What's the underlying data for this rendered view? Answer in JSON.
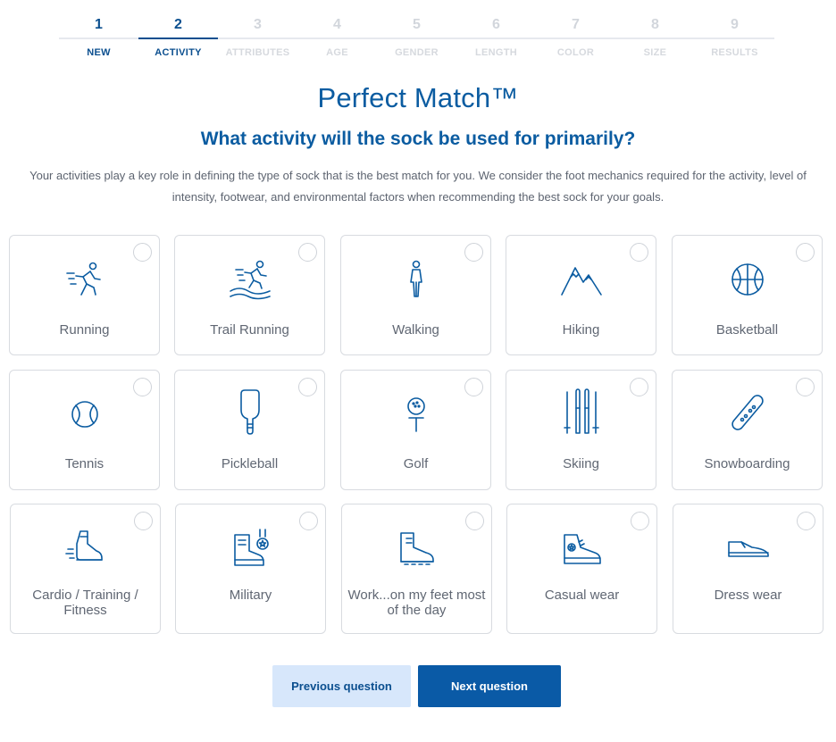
{
  "steps": [
    {
      "num": "1",
      "label": "NEW"
    },
    {
      "num": "2",
      "label": "ACTIVITY"
    },
    {
      "num": "3",
      "label": "ATTRIBUTES"
    },
    {
      "num": "4",
      "label": "AGE"
    },
    {
      "num": "5",
      "label": "GENDER"
    },
    {
      "num": "6",
      "label": "LENGTH"
    },
    {
      "num": "7",
      "label": "COLOR"
    },
    {
      "num": "8",
      "label": "SIZE"
    },
    {
      "num": "9",
      "label": "RESULTS"
    }
  ],
  "current_step": 2,
  "brand": "Perfect Match™",
  "question": "What activity will the sock be used for primarily?",
  "description": "Your activities play a key role in defining the type of sock that is the best match for you. We consider the foot mechanics required for the activity, level of intensity, footwear, and environmental factors when recommending the best sock for your goals.",
  "activities": [
    {
      "label": "Running",
      "icon": "running-icon"
    },
    {
      "label": "Trail Running",
      "icon": "trail-running-icon"
    },
    {
      "label": "Walking",
      "icon": "walking-icon"
    },
    {
      "label": "Hiking",
      "icon": "mountains-icon"
    },
    {
      "label": "Basketball",
      "icon": "basketball-icon"
    },
    {
      "label": "Tennis",
      "icon": "tennis-ball-icon"
    },
    {
      "label": "Pickleball",
      "icon": "pickleball-paddle-icon"
    },
    {
      "label": "Golf",
      "icon": "golf-ball-tee-icon"
    },
    {
      "label": "Skiing",
      "icon": "skis-icon"
    },
    {
      "label": "Snowboarding",
      "icon": "snowboard-icon"
    },
    {
      "label": "Cardio / Training / Fitness",
      "icon": "training-shoe-icon"
    },
    {
      "label": "Military",
      "icon": "military-boot-medal-icon"
    },
    {
      "label": "Work...on my feet most of the day",
      "icon": "work-boot-icon"
    },
    {
      "label": "Casual wear",
      "icon": "sneaker-icon"
    },
    {
      "label": "Dress wear",
      "icon": "dress-shoe-icon"
    }
  ],
  "buttons": {
    "previous": "Previous question",
    "next": "Next question"
  },
  "colors": {
    "primary": "#0b5ca1",
    "step_active": "#0b4f8f",
    "button_secondary_bg": "#d7e7fb",
    "button_primary_bg": "#0a5aa6"
  }
}
